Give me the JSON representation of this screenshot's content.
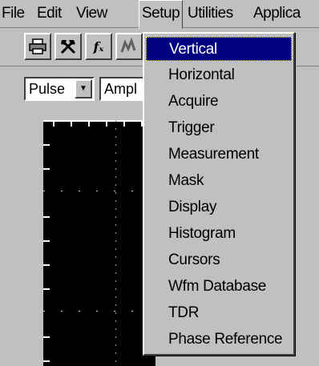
{
  "menubar": {
    "items": [
      "File",
      "Edit",
      "View",
      "Setup",
      "Utilities",
      "Applica"
    ],
    "active": "Setup"
  },
  "toolbar": {
    "buttons": [
      {
        "icon": "printer-icon"
      },
      {
        "icon": "tools-icon"
      },
      {
        "icon": "fx-icon",
        "label": "fₓ"
      },
      {
        "icon": "waveform-icon"
      }
    ]
  },
  "controls": {
    "mode_value": "Pulse",
    "measure_button_label": "Ampl"
  },
  "setup_menu": {
    "items": [
      "Vertical",
      "Horizontal",
      "Acquire",
      "Trigger",
      "Measurement",
      "Mask",
      "Display",
      "Histogram",
      "Cursors",
      "Wfm Database",
      "TDR",
      "Phase Reference"
    ],
    "selected": "Vertical",
    "highlight_color": "#000080"
  }
}
